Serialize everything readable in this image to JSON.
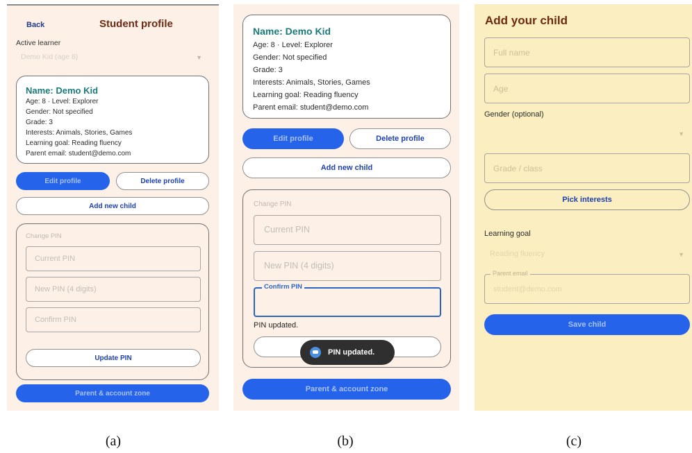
{
  "panel_a": {
    "back_label": "Back",
    "title": "Student profile",
    "active_learner_label": "Active learner",
    "active_learner_value": "Demo Kid (age 8)",
    "profile": {
      "name": "Name: Demo Kid",
      "age_level": "Age: 8 · Level: Explorer",
      "gender": "Gender: Not specified",
      "grade": "Grade: 3",
      "interests": "Interests: Animals, Stories, Games",
      "goal": "Learning goal: Reading fluency",
      "email": "Parent email: student@demo.com"
    },
    "edit_label": "Edit profile",
    "delete_label": "Delete profile",
    "add_child_label": "Add new child",
    "change_pin_label": "Change PIN",
    "current_pin_placeholder": "Current PIN",
    "new_pin_placeholder": "New PIN (4 digits)",
    "confirm_pin_placeholder": "Confirm PIN",
    "update_pin_label": "Update PIN",
    "parent_zone_label": "Parent & account zone"
  },
  "panel_b": {
    "profile": {
      "name": "Name: Demo Kid",
      "age_level": "Age: 8 · Level: Explorer",
      "gender": "Gender: Not specified",
      "grade": "Grade: 3",
      "interests": "Interests: Animals, Stories, Games",
      "goal": "Learning goal: Reading fluency",
      "email": "Parent email: student@demo.com"
    },
    "edit_label": "Edit profile",
    "delete_label": "Delete profile",
    "add_child_label": "Add new child",
    "change_pin_label": "Change PIN",
    "current_pin_placeholder": "Current PIN",
    "new_pin_placeholder": "New PIN (4 digits)",
    "confirm_pin_label": "Confirm PIN",
    "status_text": "PIN updated.",
    "toast_text": "PIN updated.",
    "parent_zone_label": "Parent & account zone"
  },
  "panel_c": {
    "title": "Add your child",
    "full_name_placeholder": "Full name",
    "age_placeholder": "Age",
    "gender_label": "Gender (optional)",
    "grade_placeholder": "Grade / class",
    "pick_interests_label": "Pick interests",
    "learning_goal_label": "Learning goal",
    "learning_goal_value": "Reading fluency",
    "parent_email_label": "Parent email",
    "parent_email_value": "student@demo.com",
    "save_label": "Save child"
  },
  "captions": [
    "(a)",
    "(b)",
    "(c)"
  ],
  "colors": {
    "panel_bg": "#fdf1e7",
    "panel_c_bg": "#fbeec0",
    "primary": "#2563eb",
    "title": "#6b2a12",
    "name": "#1c7a7a"
  }
}
